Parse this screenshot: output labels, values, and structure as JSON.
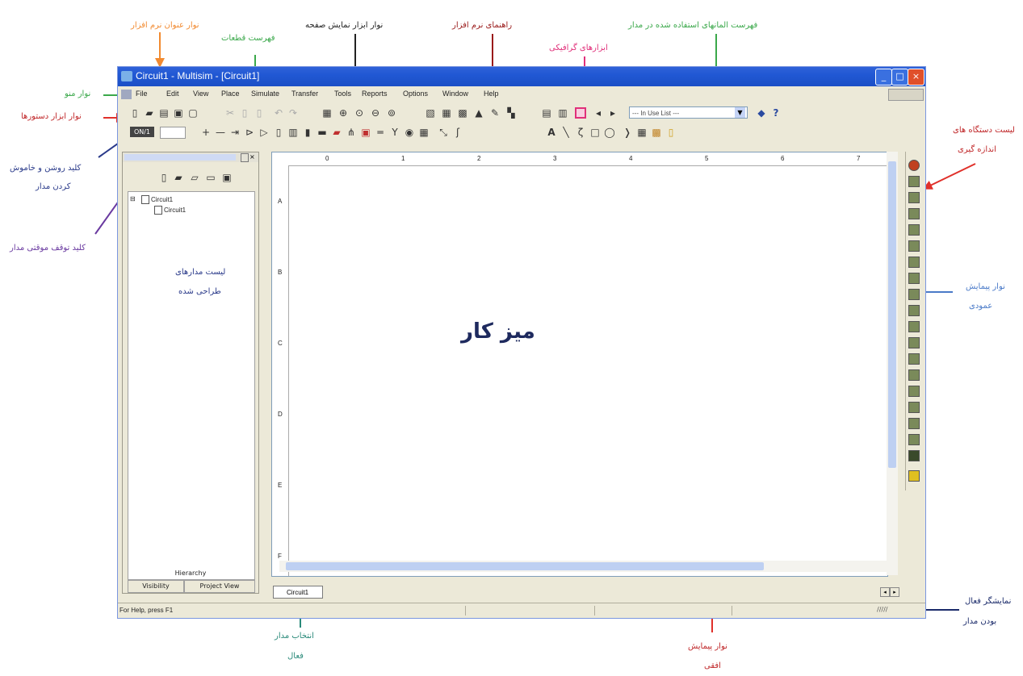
{
  "annotations": {
    "title_bar": "نوار عنوان نرم افزار",
    "page_view_tools": "نوار ابزار نمایش صفحه",
    "software_guide": "راهنمای نرم افزار",
    "components_list": "فهرست قطعات",
    "in_use_list": "فهرست المانهای استفاده شده در مدار",
    "graphic_tools": "ابزارهای گرافیکی",
    "menu_bar": "نوار منو",
    "command_toolbar": "نوار ابزار دستورها",
    "power_switch_1": "کلید روشن و خاموش",
    "power_switch_2": "کردن مدار",
    "pause_switch": "کلید توقف موقتی مدار",
    "designed_list_1": "لیست مدارهای",
    "designed_list_2": "طراحی شده",
    "workbench": "میز کار",
    "instruments_1": "لیست دستگاه های",
    "instruments_2": "اندازه گیری",
    "vscroll_1": "نوار پیمایش",
    "vscroll_2": "عمودی",
    "active_circuit_1": "انتخاب مدار",
    "active_circuit_2": "فعال",
    "hscroll_1": "نوار پیمایش",
    "hscroll_2": "افقی",
    "active_indicator_1": "نمایشگر فعال",
    "active_indicator_2": "بودن مدار"
  },
  "window": {
    "title": "Circuit1 - Multisim - [Circuit1]",
    "minimize": "_",
    "maximize": "□",
    "close": "×"
  },
  "menu": [
    "File",
    "Edit",
    "View",
    "Place",
    "Simulate",
    "Transfer",
    "Tools",
    "Reports",
    "Options",
    "Window",
    "Help"
  ],
  "toolbar": {
    "in_use_combo": "--- In Use List ---",
    "power_label": "ON/1",
    "help_glyph": "?"
  },
  "toolbox": {
    "tree_root": "Circuit1",
    "tree_child": "Circuit1",
    "tab_hierarchy": "Hierarchy",
    "tab_visibility": "Visibility",
    "tab_project": "Project View"
  },
  "workspace": {
    "circuit_tab": "Circuit1",
    "ruler_top": [
      "0",
      "1",
      "2",
      "3",
      "4",
      "5",
      "6",
      "7"
    ],
    "ruler_left": [
      "A",
      "B",
      "C",
      "D",
      "E",
      "F"
    ]
  },
  "statusbar": {
    "help_text": "For Help, press F1",
    "indicator": "/////"
  },
  "colors": {
    "title_blue": "#2158d4",
    "chrome": "#ece9d8",
    "scroll_thumb": "#bed0f2"
  }
}
